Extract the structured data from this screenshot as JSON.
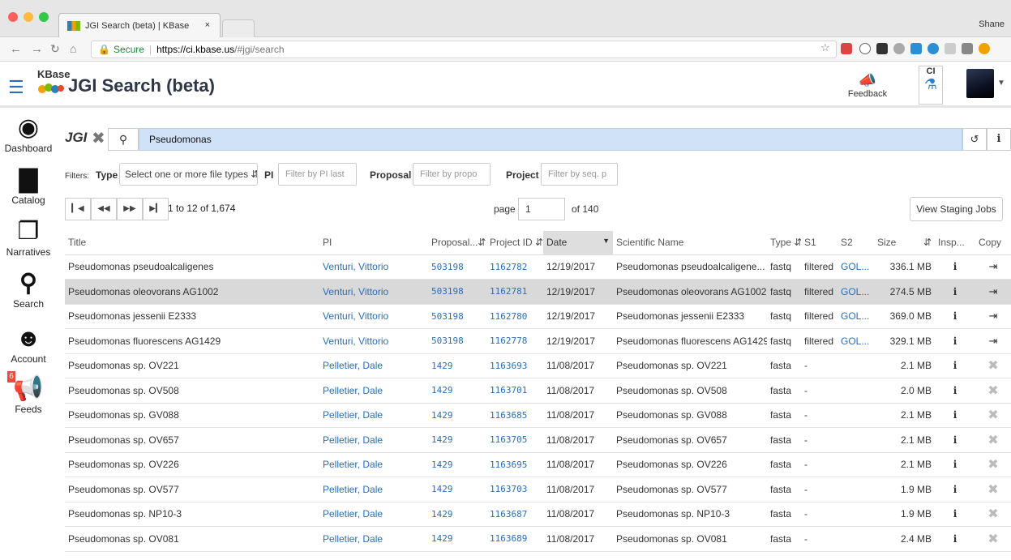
{
  "browser": {
    "tab_title": "JGI Search (beta) | KBase",
    "tab_close": "×",
    "user": "Shane",
    "url_secure": "Secure",
    "url_host": "https://ci.kbase.us",
    "url_path": "/#jgi/search"
  },
  "header": {
    "kbase_word": "KBase",
    "title": "JGI Search (beta)",
    "feedback": "Feedback",
    "env": "CI"
  },
  "sidenav": {
    "items": [
      {
        "label": "Dashboard",
        "icon": "dashboard-icon"
      },
      {
        "label": "Catalog",
        "icon": "book-icon"
      },
      {
        "label": "Narratives",
        "icon": "narratives-icon"
      },
      {
        "label": "Search",
        "icon": "search-icon"
      },
      {
        "label": "Account",
        "icon": "account-icon"
      },
      {
        "label": "Feeds",
        "icon": "megaphone-icon"
      }
    ],
    "feeds_badge": "6"
  },
  "search": {
    "logo": "JGI",
    "query": "Pseudomonas"
  },
  "filters": {
    "label": "Filters:",
    "type_label": "Type",
    "type_placeholder": "Select one or more file types",
    "pi_label": "PI",
    "pi_placeholder": "Filter by PI last",
    "proposal_label": "Proposal",
    "proposal_placeholder": "Filter by propo",
    "project_label": "Project",
    "project_placeholder": "Filter by seq. p"
  },
  "pager": {
    "range": "1 to 12 of 1,674",
    "page_label": "page",
    "page_value": "1",
    "of_label": "of 140",
    "staging_button": "View Staging Jobs"
  },
  "table": {
    "columns": [
      "Title",
      "PI",
      "Proposal...",
      "Project ID",
      "Date",
      "Scientific Name",
      "Type",
      "S1",
      "S2",
      "Size",
      "Insp...",
      "Copy"
    ],
    "rows": [
      {
        "title": "Pseudomonas pseudoalcaligenes",
        "pi": "Venturi, Vittorio",
        "proposal": "503198",
        "project": "1162782",
        "date": "12/19/2017",
        "sci": "Pseudomonas pseudoalcaligene...",
        "type": "fastq",
        "s1": "filtered",
        "s2": "GOL...",
        "size": "336.1 MB",
        "copy": "arrow"
      },
      {
        "title": "Pseudomonas oleovorans AG1002",
        "pi": "Venturi, Vittorio",
        "proposal": "503198",
        "project": "1162781",
        "date": "12/19/2017",
        "sci": "Pseudomonas oleovorans AG1002",
        "type": "fastq",
        "s1": "filtered",
        "s2": "GOL...",
        "size": "274.5 MB",
        "copy": "arrow"
      },
      {
        "title": "Pseudomonas jessenii E2333",
        "pi": "Venturi, Vittorio",
        "proposal": "503198",
        "project": "1162780",
        "date": "12/19/2017",
        "sci": "Pseudomonas jessenii E2333",
        "type": "fastq",
        "s1": "filtered",
        "s2": "GOL...",
        "size": "369.0 MB",
        "copy": "arrow"
      },
      {
        "title": "Pseudomonas fluorescens AG1429",
        "pi": "Venturi, Vittorio",
        "proposal": "503198",
        "project": "1162778",
        "date": "12/19/2017",
        "sci": "Pseudomonas fluorescens AG1429",
        "type": "fastq",
        "s1": "filtered",
        "s2": "GOL...",
        "size": "329.1 MB",
        "copy": "arrow"
      },
      {
        "title": "Pseudomonas sp. OV221",
        "pi": "Pelletier, Dale",
        "proposal": "1429",
        "project": "1163693",
        "date": "11/08/2017",
        "sci": "Pseudomonas sp. OV221",
        "type": "fasta",
        "s1": "-",
        "s2": "",
        "size": "2.1 MB",
        "copy": "helix"
      },
      {
        "title": "Pseudomonas sp. OV508",
        "pi": "Pelletier, Dale",
        "proposal": "1429",
        "project": "1163701",
        "date": "11/08/2017",
        "sci": "Pseudomonas sp. OV508",
        "type": "fasta",
        "s1": "-",
        "s2": "",
        "size": "2.0 MB",
        "copy": "helix"
      },
      {
        "title": "Pseudomonas sp. GV088",
        "pi": "Pelletier, Dale",
        "proposal": "1429",
        "project": "1163685",
        "date": "11/08/2017",
        "sci": "Pseudomonas sp. GV088",
        "type": "fasta",
        "s1": "-",
        "s2": "",
        "size": "2.1 MB",
        "copy": "helix"
      },
      {
        "title": "Pseudomonas sp. OV657",
        "pi": "Pelletier, Dale",
        "proposal": "1429",
        "project": "1163705",
        "date": "11/08/2017",
        "sci": "Pseudomonas sp. OV657",
        "type": "fasta",
        "s1": "-",
        "s2": "",
        "size": "2.1 MB",
        "copy": "helix"
      },
      {
        "title": "Pseudomonas sp. OV226",
        "pi": "Pelletier, Dale",
        "proposal": "1429",
        "project": "1163695",
        "date": "11/08/2017",
        "sci": "Pseudomonas sp. OV226",
        "type": "fasta",
        "s1": "-",
        "s2": "",
        "size": "2.1 MB",
        "copy": "helix"
      },
      {
        "title": "Pseudomonas sp. OV577",
        "pi": "Pelletier, Dale",
        "proposal": "1429",
        "project": "1163703",
        "date": "11/08/2017",
        "sci": "Pseudomonas sp. OV577",
        "type": "fasta",
        "s1": "-",
        "s2": "",
        "size": "1.9 MB",
        "copy": "helix"
      },
      {
        "title": "Pseudomonas sp. NP10-3",
        "pi": "Pelletier, Dale",
        "proposal": "1429",
        "project": "1163687",
        "date": "11/08/2017",
        "sci": "Pseudomonas sp. NP10-3",
        "type": "fasta",
        "s1": "-",
        "s2": "",
        "size": "1.9 MB",
        "copy": "helix"
      },
      {
        "title": "Pseudomonas sp. OV081",
        "pi": "Pelletier, Dale",
        "proposal": "1429",
        "project": "1163689",
        "date": "11/08/2017",
        "sci": "Pseudomonas sp. OV081",
        "type": "fasta",
        "s1": "-",
        "s2": "",
        "size": "2.4 MB",
        "copy": "helix"
      }
    ],
    "selected_row": 1
  }
}
